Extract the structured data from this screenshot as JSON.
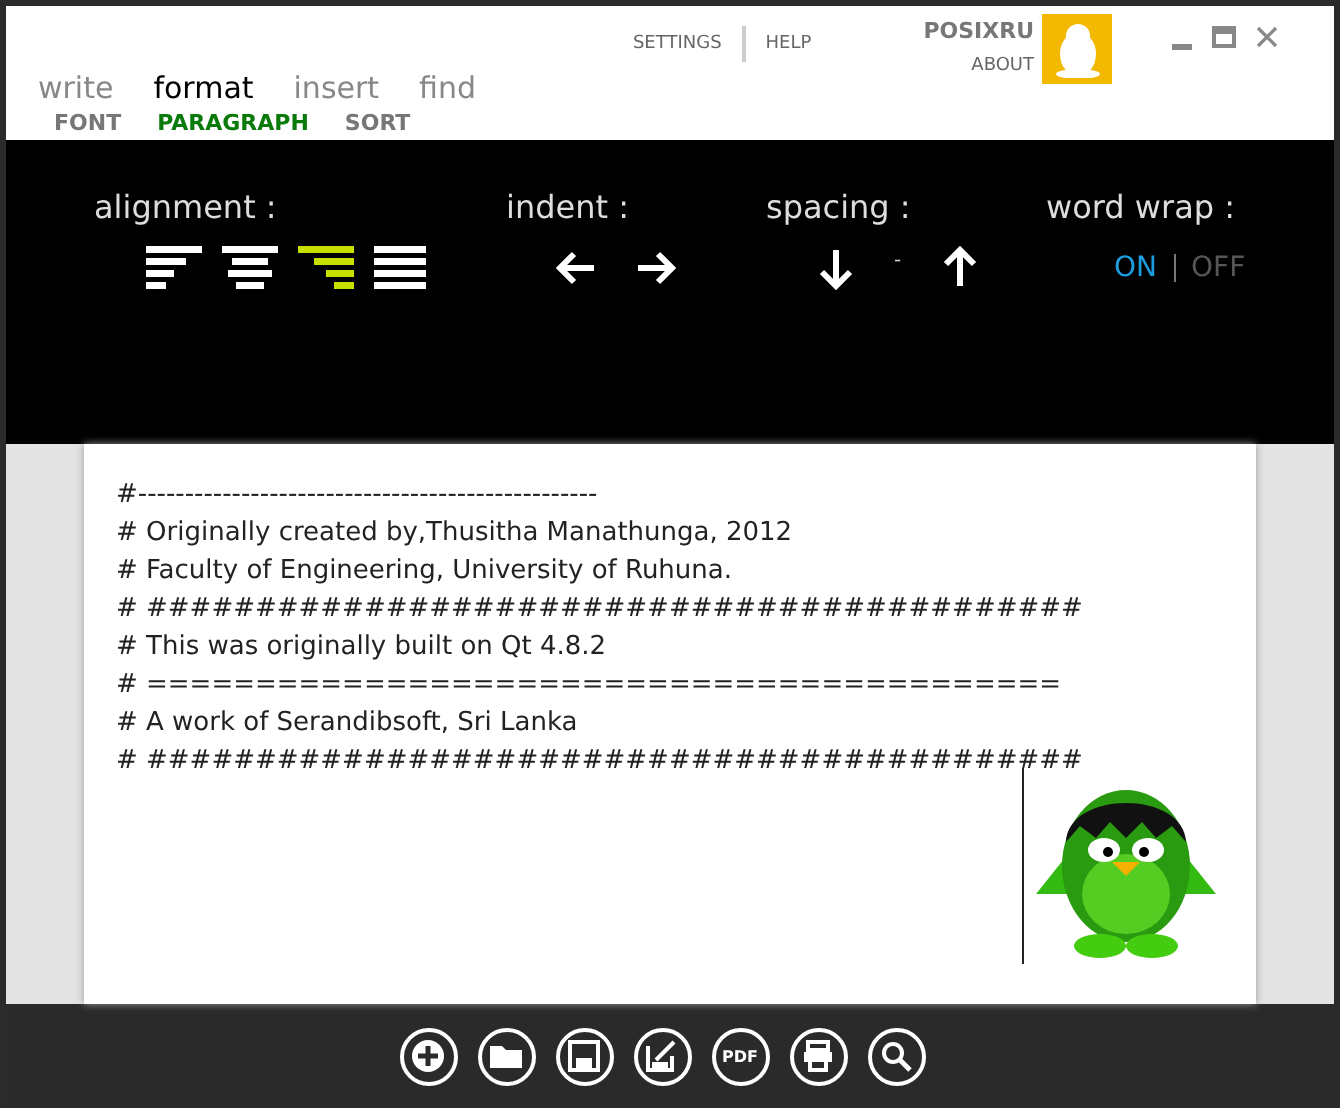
{
  "header_links": [
    {
      "label": "SETTINGS"
    },
    {
      "label": "HELP"
    }
  ],
  "account": {
    "name": "POSIXRU",
    "link": "ABOUT"
  },
  "tabs": [
    {
      "label": "write",
      "selected": false
    },
    {
      "label": "format",
      "selected": true
    },
    {
      "label": "insert",
      "selected": false
    },
    {
      "label": "find",
      "selected": false
    }
  ],
  "subtabs": [
    {
      "label": "FONT",
      "selected": false
    },
    {
      "label": "PARAGRAPH",
      "selected": true
    },
    {
      "label": "SORT",
      "selected": false
    }
  ],
  "alignment": {
    "label": "alignment :",
    "options": [
      {
        "kind": "left",
        "selected": false
      },
      {
        "kind": "center",
        "selected": false
      },
      {
        "kind": "right",
        "selected": true
      },
      {
        "kind": "justify",
        "selected": false
      }
    ]
  },
  "indent": {
    "label": "indent :"
  },
  "spacing": {
    "label": "spacing :",
    "value": "-"
  },
  "word_wrap": {
    "label": "word wrap :",
    "options": [
      {
        "label": "ON",
        "selected": true
      },
      {
        "label": "OFF",
        "selected": false
      }
    ]
  },
  "document": {
    "lines": [
      "#-------------------------------------------------",
      "# Originally created by,Thusitha Manathunga, 2012",
      "# Faculty of Engineering, University of Ruhuna.",
      "# ###########################################",
      "# This was originally built on Qt 4.8.2",
      "# ==========================================",
      "# A work of Serandibsoft, Sri Lanka",
      "# ###########################################"
    ]
  },
  "bottom_bar": {
    "buttons": [
      {
        "kind": "new"
      },
      {
        "kind": "open"
      },
      {
        "kind": "save"
      },
      {
        "kind": "save-as"
      },
      {
        "kind": "pdf",
        "label": "PDF"
      },
      {
        "kind": "print"
      },
      {
        "kind": "search"
      }
    ]
  }
}
